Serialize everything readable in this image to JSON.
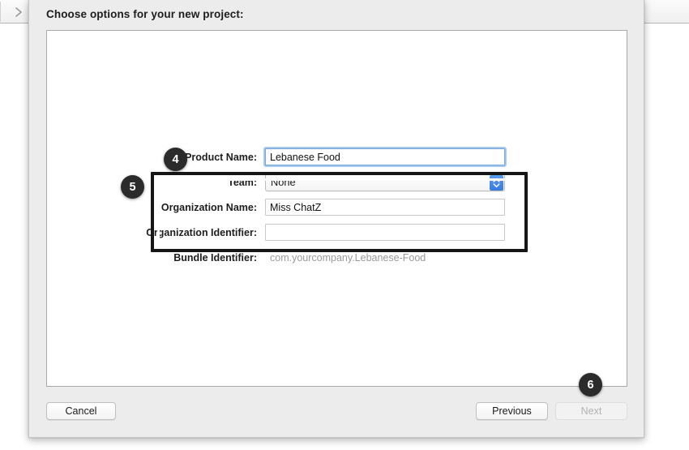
{
  "backdrop": {
    "nav_forward_icon": "chevron-right-icon"
  },
  "sheet": {
    "title": "Choose options for your new project:"
  },
  "form": {
    "rows": [
      {
        "label": "Product Name:",
        "value": "Lebanese Food",
        "type": "text",
        "focused": true
      },
      {
        "label": "Team:",
        "value": "None",
        "type": "popup"
      },
      {
        "label": "Organization Name:",
        "value": "Miss ChatZ",
        "type": "text"
      },
      {
        "label": "Organization Identifier:",
        "value": "",
        "type": "text"
      },
      {
        "label": "Bundle Identifier:",
        "value": "com.yourcompany.Lebanese-Food",
        "type": "static"
      }
    ]
  },
  "annotations": {
    "badges": [
      {
        "number": "4",
        "target": "product-name-row"
      },
      {
        "number": "5",
        "target": "team-organization-group"
      },
      {
        "number": "6",
        "target": "next-button"
      }
    ],
    "group_outline": "team-organization-group"
  },
  "buttons": {
    "cancel": "Cancel",
    "previous": "Previous",
    "next": "Next"
  },
  "colors": {
    "badge_bg": "#2b2b2b",
    "stepper_blue": "#3b7ee0",
    "focus_ring": "#6ea8e5",
    "sheet_bg": "#ececec",
    "muted_text": "#9a9a9a"
  }
}
